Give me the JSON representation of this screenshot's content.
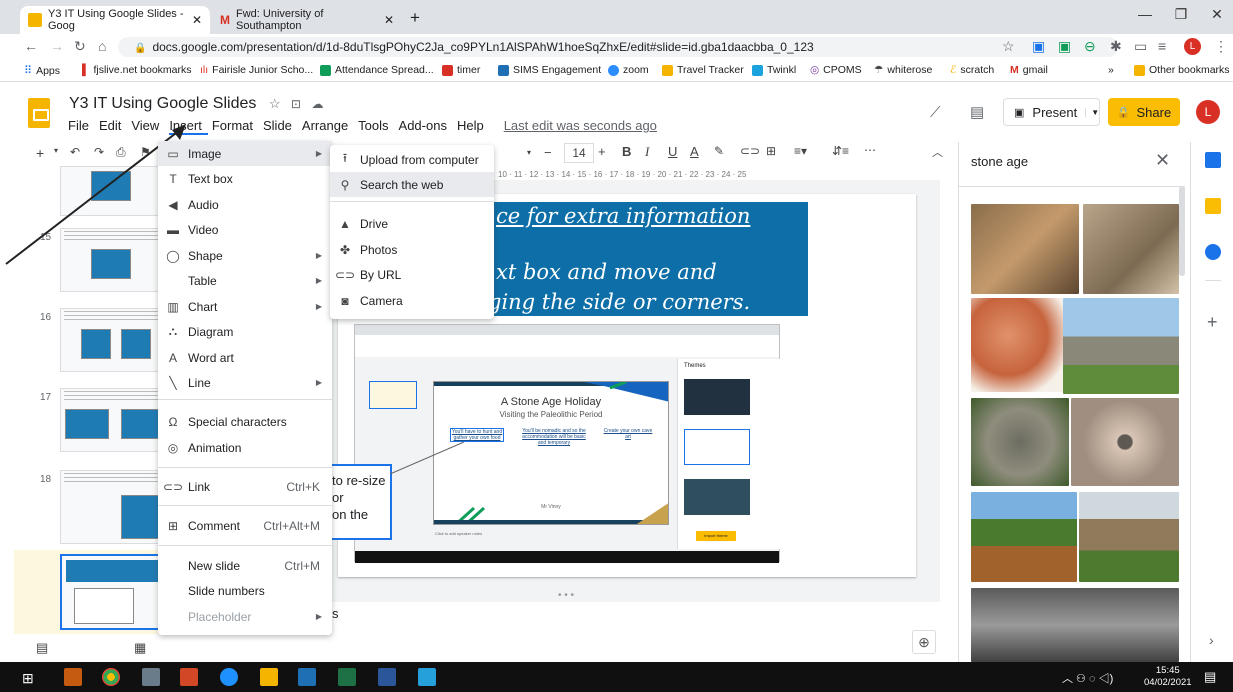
{
  "browser": {
    "tabs": [
      {
        "title": "Y3 IT Using Google Slides - Goog"
      },
      {
        "title": "Fwd: University of Southampton"
      }
    ],
    "url": "docs.google.com/presentation/d/1d-8duTlsgPOhyC2Ja_co9PYLn1AlSPAhW1hoeSqZhxE/edit#slide=id.gba1daacbba_0_123",
    "profile_initial": "L",
    "bookmarks": [
      "Apps",
      "fjslive.net bookmarks",
      "Fairisle Junior Scho...",
      "Attendance Spread...",
      "timer",
      "SIMS Engagement",
      "zoom",
      "Travel Tracker",
      "Twinkl",
      "CPOMS",
      "whiterose",
      "scratch",
      "gmail"
    ],
    "bookmarks_more": "»",
    "other_bookmarks": "Other bookmarks"
  },
  "doc": {
    "title": "Y3 IT Using Google Slides",
    "menus": [
      "File",
      "Edit",
      "View",
      "Insert",
      "Format",
      "Slide",
      "Arrange",
      "Tools",
      "Add-ons",
      "Help"
    ],
    "last_edit": "Last edit was seconds ago",
    "present_label": "Present",
    "share_label": "Share",
    "avatar_initial": "L"
  },
  "toolbar": {
    "font_size": "14",
    "ruler": "10 · 11 · 12 · 13 · 14 · 15 · 16 · 17 · 18 · 19 · 20 · 21 · 22 · 23 · 24 · 25"
  },
  "filmstrip": {
    "slides": [
      {
        "num": "15",
        "caption": "Or use a shortcut by pressing ctrl and m at the same time."
      },
      {
        "num": "16",
        "caption": "Or press the 1 sign! There's usually a lot of different ways to do things."
      },
      {
        "num": "17",
        "caption": "If you make a mistake you can undo your action, or redo it if you decide you want to keep it instead."
      },
      {
        "num": "18",
        "caption": "When you add a slide it gives lots of layout options."
      },
      {
        "num": "19",
        "caption": "Click on the box and move it, and re-size by dragging the side or corners."
      }
    ]
  },
  "slide": {
    "line1": "ce for extra information",
    "line2": "xt box and move and",
    "line3": "ging the side or corners.",
    "callout_lines": [
      "to re-size",
      "or",
      "on the"
    ],
    "notes_fragment": "s",
    "inner": {
      "title": "A Stone Age Holiday",
      "subtitle": "Visiting the Paleolithic Period",
      "col1": "You'll have to hunt and gather your own food",
      "col2": "You'll be nomadic and so the accommodation will be basic and temporary",
      "col3": "Create your own cave art",
      "footer": "Mr Vinny",
      "themes": "Themes",
      "import_theme": "Import theme",
      "speaker_notes": "Click to add speaker notes"
    }
  },
  "insert_menu": {
    "items": [
      {
        "icon": "image-icon",
        "glyph": "▭",
        "label": "Image",
        "shortcut": "",
        "submenu": true
      },
      {
        "icon": "textbox-icon",
        "glyph": "T",
        "label": "Text box",
        "shortcut": "",
        "submenu": false
      },
      {
        "icon": "audio-icon",
        "glyph": "◀",
        "label": "Audio",
        "shortcut": "",
        "submenu": false
      },
      {
        "icon": "video-icon",
        "glyph": "▬",
        "label": "Video",
        "shortcut": "",
        "submenu": false
      },
      {
        "icon": "shape-icon",
        "glyph": "◯",
        "label": "Shape",
        "shortcut": "",
        "submenu": true
      },
      {
        "icon": "table-icon",
        "glyph": "",
        "label": "Table",
        "shortcut": "",
        "submenu": true
      },
      {
        "icon": "chart-icon",
        "glyph": "▥",
        "label": "Chart",
        "shortcut": "",
        "submenu": true
      },
      {
        "icon": "diagram-icon",
        "glyph": "⛬",
        "label": "Diagram",
        "shortcut": "",
        "submenu": false
      },
      {
        "icon": "wordart-icon",
        "glyph": "A",
        "label": "Word art",
        "shortcut": "",
        "submenu": false
      },
      {
        "icon": "line-icon",
        "glyph": "╲",
        "label": "Line",
        "shortcut": "",
        "submenu": true
      },
      {
        "icon": "omega-icon",
        "glyph": "Ω",
        "label": "Special characters",
        "shortcut": "",
        "submenu": false
      },
      {
        "icon": "animation-icon",
        "glyph": "◎",
        "label": "Animation",
        "shortcut": "",
        "submenu": false
      },
      {
        "icon": "link-icon",
        "glyph": "⊂⊃",
        "label": "Link",
        "shortcut": "Ctrl+K",
        "submenu": false
      },
      {
        "icon": "comment-icon",
        "glyph": "⊞",
        "label": "Comment",
        "shortcut": "Ctrl+Alt+M",
        "submenu": false
      },
      {
        "icon": "",
        "glyph": "",
        "label": "New slide",
        "shortcut": "Ctrl+M",
        "submenu": false
      },
      {
        "icon": "",
        "glyph": "",
        "label": "Slide numbers",
        "shortcut": "",
        "submenu": false
      },
      {
        "icon": "",
        "glyph": "",
        "label": "Placeholder",
        "shortcut": "",
        "submenu": true
      }
    ]
  },
  "image_submenu": {
    "items": [
      {
        "icon": "upload-icon",
        "glyph": "⭱",
        "label": "Upload from computer"
      },
      {
        "icon": "search-icon",
        "glyph": "⚲",
        "label": "Search the web"
      },
      {
        "icon": "drive-icon",
        "glyph": "▲",
        "label": "Drive"
      },
      {
        "icon": "photos-icon",
        "glyph": "✤",
        "label": "Photos"
      },
      {
        "icon": "link-icon",
        "glyph": "⊂⊃",
        "label": "By URL"
      },
      {
        "icon": "camera-icon",
        "glyph": "◙",
        "label": "Camera"
      }
    ]
  },
  "search_panel": {
    "query": "stone age"
  },
  "taskbar": {
    "time": "15:45",
    "date": "04/02/2021"
  },
  "colors": {
    "accent": "#1a73e8",
    "share": "#fbbc04",
    "slide_banner": "#0e6fa8"
  }
}
